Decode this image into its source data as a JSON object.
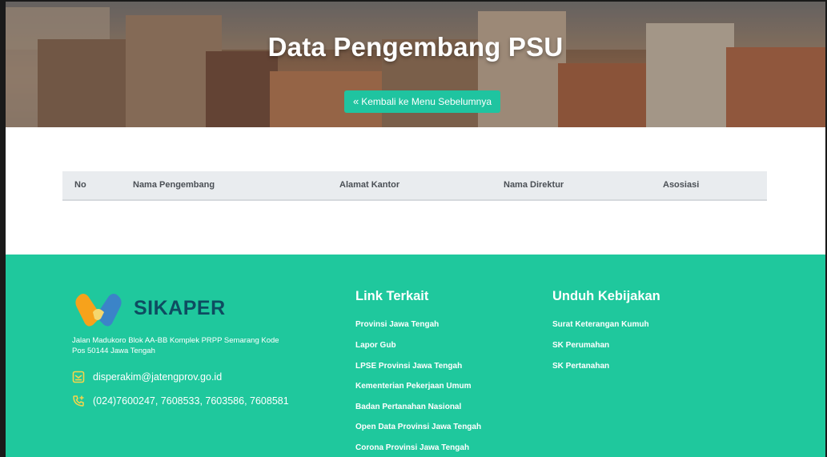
{
  "hero": {
    "title": "Data Pengembang PSU",
    "back_label": "Kembali ke Menu Sebelumnya"
  },
  "table": {
    "columns": [
      "No",
      "Nama Pengembang",
      "Alamat Kantor",
      "Nama Direktur",
      "Asosiasi"
    ],
    "rows": []
  },
  "footer": {
    "brand": "SIKAPER",
    "address": "Jalan Madukoro Blok AA-BB Komplek PRPP Semarang Kode Pos 50144 Jawa Tengah",
    "email": "disperakim@jatengprov.go.id",
    "phone": "(024)7600247, 7608533, 7603586, 7608581",
    "link_terkait": {
      "title": "Link Terkait",
      "items": [
        "Provinsi Jawa Tengah",
        "Lapor Gub",
        "LPSE Provinsi Jawa Tengah",
        "Kementerian Pekerjaan Umum",
        "Badan Pertanahan Nasional",
        "Open Data Provinsi Jawa Tengah",
        "Corona Provinsi Jawa Tengah"
      ]
    },
    "unduh_kebijakan": {
      "title": "Unduh Kebijakan",
      "items": [
        "Surat Keterangan Kumuh",
        "SK Perumahan",
        "SK Pertanahan"
      ]
    }
  },
  "colors": {
    "accent": "#1fc89d",
    "button": "#1fc4a0",
    "brand_text": "#0e4c61",
    "table_header_bg": "#e9ecef"
  },
  "icons": {
    "back": "chevron-double-left-icon",
    "email": "email-icon",
    "phone": "phone-icon"
  }
}
